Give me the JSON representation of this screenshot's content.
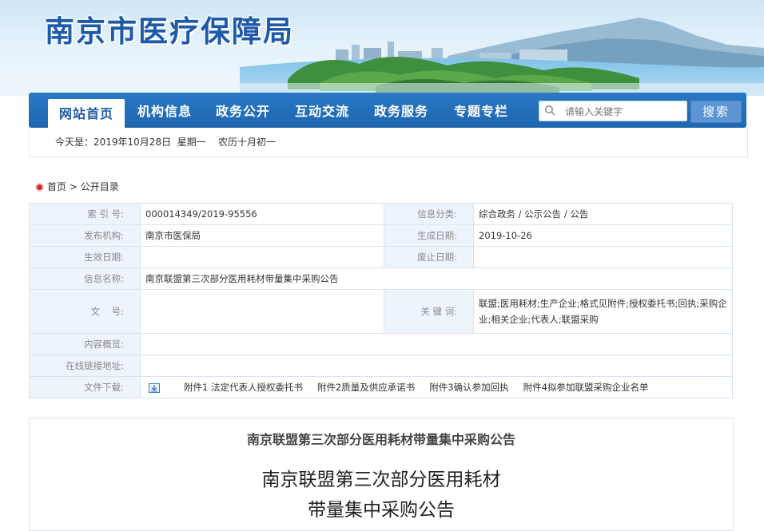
{
  "site": {
    "title": "南京市医疗保障局"
  },
  "nav": {
    "items": [
      "网站首页",
      "机构信息",
      "政务公开",
      "互动交流",
      "政务服务",
      "专题专栏"
    ],
    "active_index": 0,
    "search_placeholder": "请输入关键字",
    "search_button": "搜索"
  },
  "datebar": {
    "text": "今天是：2019年10月28日  星期一    农历十月初一"
  },
  "breadcrumb": {
    "home": "首页",
    "sep": ">",
    "current": "公开目录"
  },
  "info": {
    "index_label": "索 引 号:",
    "index_value": "000014349/2019-95556",
    "category_label": "信息分类:",
    "category_value": "综合政务 / 公示公告 / 公告",
    "publisher_label": "发布机构:",
    "publisher_value": "南京市医保局",
    "created_label": "生成日期:",
    "created_value": "2019-10-26",
    "effective_label": "生效日期:",
    "effective_value": "",
    "abolish_label": "废止日期:",
    "abolish_value": "",
    "name_label": "信息名称:",
    "name_value": "南京联盟第三次部分医用耗材带量集中采购公告",
    "docno_label": "文    号:",
    "docno_value": "",
    "keywords_label": "关 键 词:",
    "keywords_value": "联盟;医用耗材;生产企业;格式见附件;授权委托书;回执;采购企业;相关企业;代表人;联盟采购",
    "summary_label": "内容概览:",
    "summary_value": "",
    "link_label": "在线链接地址:",
    "link_value": "",
    "download_label": "文件下载:",
    "attachments": [
      "附件1 法定代表人授权委托书",
      "附件2质量及供应承诺书",
      "附件3确认参加回执",
      "附件4拟参加联盟采购企业名单"
    ]
  },
  "article": {
    "subtitle": "南京联盟第三次部分医用耗材带量集中采购公告",
    "title_line1": "南京联盟第三次部分医用耗材",
    "title_line2": "带量集中采购公告"
  },
  "colors": {
    "nav_blue": "#1f66b0",
    "title_blue": "#1e5aa8",
    "label_bg": "#eef4fb",
    "border": "#d9e4ef"
  }
}
